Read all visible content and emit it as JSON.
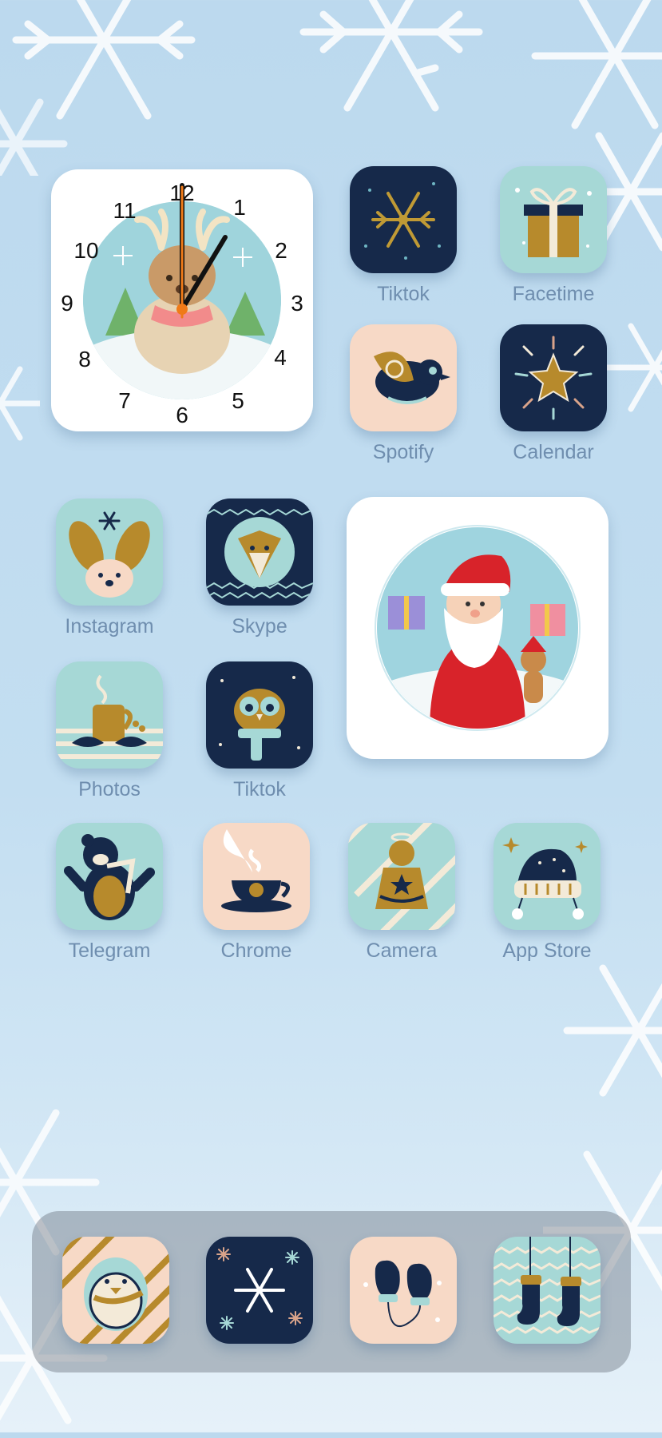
{
  "clock_widget": {
    "numerals": [
      "12",
      "1",
      "2",
      "3",
      "4",
      "5",
      "6",
      "7",
      "8",
      "9",
      "10",
      "11"
    ],
    "accent_color": "#f07a18"
  },
  "apps": [
    {
      "label": "Tiktok",
      "icon": "snowflake-icon"
    },
    {
      "label": "Facetime",
      "icon": "gift-box-icon"
    },
    {
      "label": "Spotify",
      "icon": "bird-icon"
    },
    {
      "label": "Calendar",
      "icon": "star-burst-icon"
    },
    {
      "label": "Instagram",
      "icon": "bunny-icon"
    },
    {
      "label": "Skype",
      "icon": "fox-icon"
    },
    {
      "label": "Photos",
      "icon": "cocoa-mug-icon"
    },
    {
      "label": "Tiktok",
      "icon": "owl-icon"
    },
    {
      "label": "Telegram",
      "icon": "bear-icon"
    },
    {
      "label": "Chrome",
      "icon": "tea-cup-icon"
    },
    {
      "label": "Camera",
      "icon": "gingerbread-angel-icon"
    },
    {
      "label": "App Store",
      "icon": "winter-hat-icon"
    }
  ],
  "dock": [
    {
      "icon": "penguin-icon"
    },
    {
      "icon": "snowflakes-icon"
    },
    {
      "icon": "mittens-icon"
    },
    {
      "icon": "socks-icon"
    }
  ],
  "colors": {
    "navy": "#16294a",
    "mint": "#a6d8d6",
    "peach": "#f7d9c6",
    "gold": "#b78a2c",
    "label": "#6f8eaf"
  }
}
